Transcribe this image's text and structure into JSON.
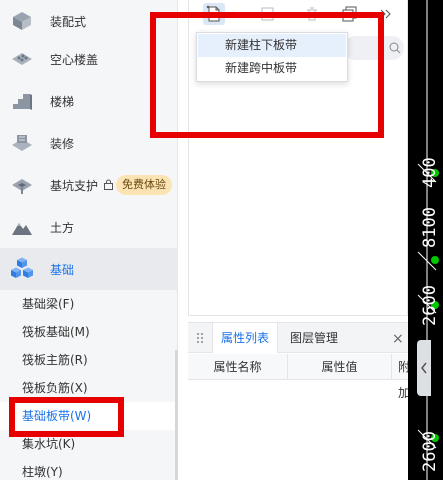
{
  "sidebar": {
    "categories": [
      {
        "label": "装配式",
        "icon": "prefab-icon"
      },
      {
        "label": "空心楼盖",
        "icon": "hollow-floor-icon"
      },
      {
        "label": "楼梯",
        "icon": "stairs-icon"
      },
      {
        "label": "装修",
        "icon": "decoration-icon"
      },
      {
        "label": "基坑支护",
        "icon": "pit-support-icon",
        "badge": "免费体验"
      },
      {
        "label": "土方",
        "icon": "earthwork-icon"
      },
      {
        "label": "基础",
        "icon": "foundation-icon"
      }
    ],
    "subitems": [
      {
        "label": "基础梁(F)"
      },
      {
        "label": "筏板基础(M)"
      },
      {
        "label": "筏板主筋(R)"
      },
      {
        "label": "筏板负筋(X)"
      },
      {
        "label": "基础板带(W)"
      },
      {
        "label": "集水坑(K)"
      },
      {
        "label": "柱墩(Y)"
      }
    ]
  },
  "dropdown": {
    "items": [
      {
        "label": "新建柱下板带"
      },
      {
        "label": "新建跨中板带"
      }
    ]
  },
  "properties": {
    "tabs": [
      {
        "label": "属性列表"
      },
      {
        "label": "图层管理"
      }
    ],
    "close": "×",
    "columns": [
      "属性名称",
      "属性值",
      "附加"
    ]
  },
  "canvas": {
    "labels": [
      "400",
      "8100",
      "2600",
      "2600"
    ]
  },
  "colors": {
    "accent": "#1a73e8",
    "highlight": "#e60000",
    "badge_bg": "#fbe3b4"
  }
}
